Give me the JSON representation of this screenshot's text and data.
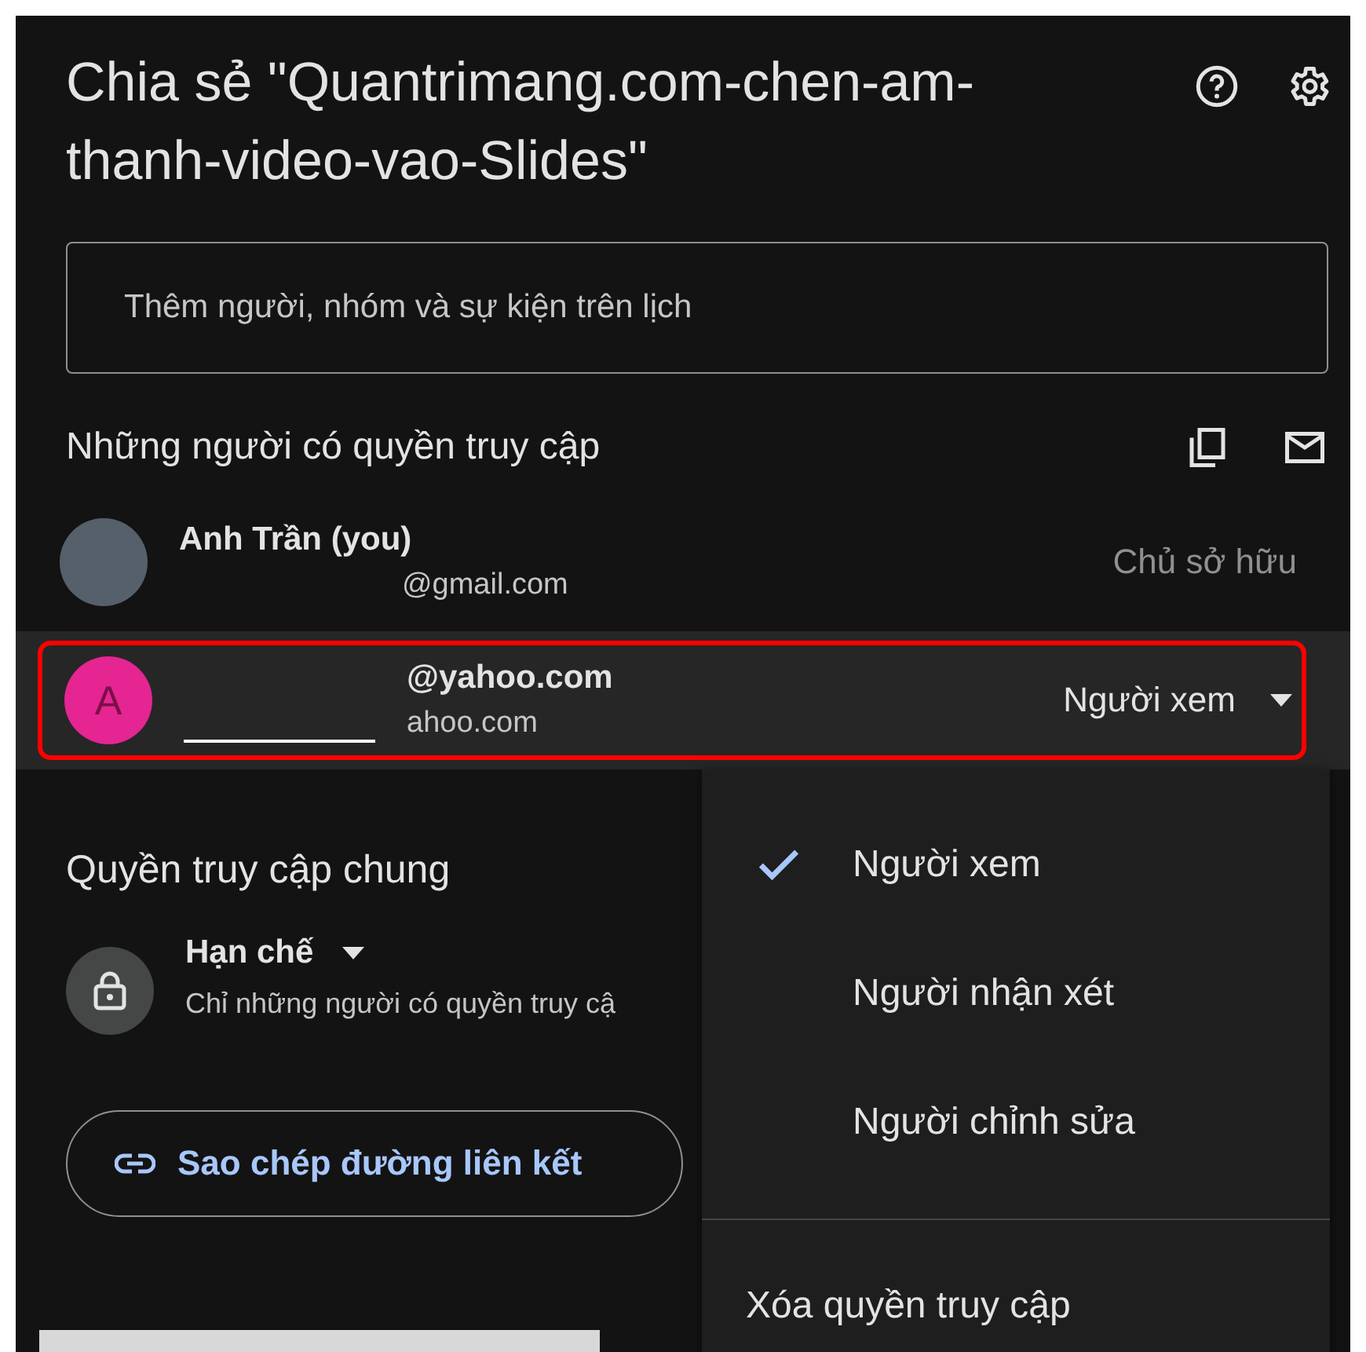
{
  "dialog": {
    "title": "Chia sẻ \"Quantrimang.com-chen-am-thanh-video-vao-Slides\""
  },
  "add_people_field": {
    "placeholder": "Thêm người, nhóm và sự kiện trên lịch"
  },
  "people_section": {
    "heading": "Những người có quyền truy cập"
  },
  "members": [
    {
      "kind": "photo",
      "name": "Anh Trần (you)",
      "email": "@gmail.com",
      "role": "Chủ sở hữu",
      "highlighted": false
    },
    {
      "kind": "letter",
      "initial": "A",
      "color": "#e52592",
      "name": "@yahoo.com",
      "email": "ahoo.com",
      "role": "Người xem",
      "highlighted": true
    }
  ],
  "general_access": {
    "heading": "Quyền truy cập chung",
    "setting": "Hạn chế",
    "description": "Chỉ những người có quyền truy cậ"
  },
  "copy_link_button": {
    "label": "Sao chép đường liên kết"
  },
  "role_menu": {
    "items": [
      {
        "label": "Người xem",
        "selected": true
      },
      {
        "label": "Người nhận xét",
        "selected": false
      },
      {
        "label": "Người chỉnh sửa",
        "selected": false
      }
    ],
    "remove_label": "Xóa quyền truy cập"
  }
}
